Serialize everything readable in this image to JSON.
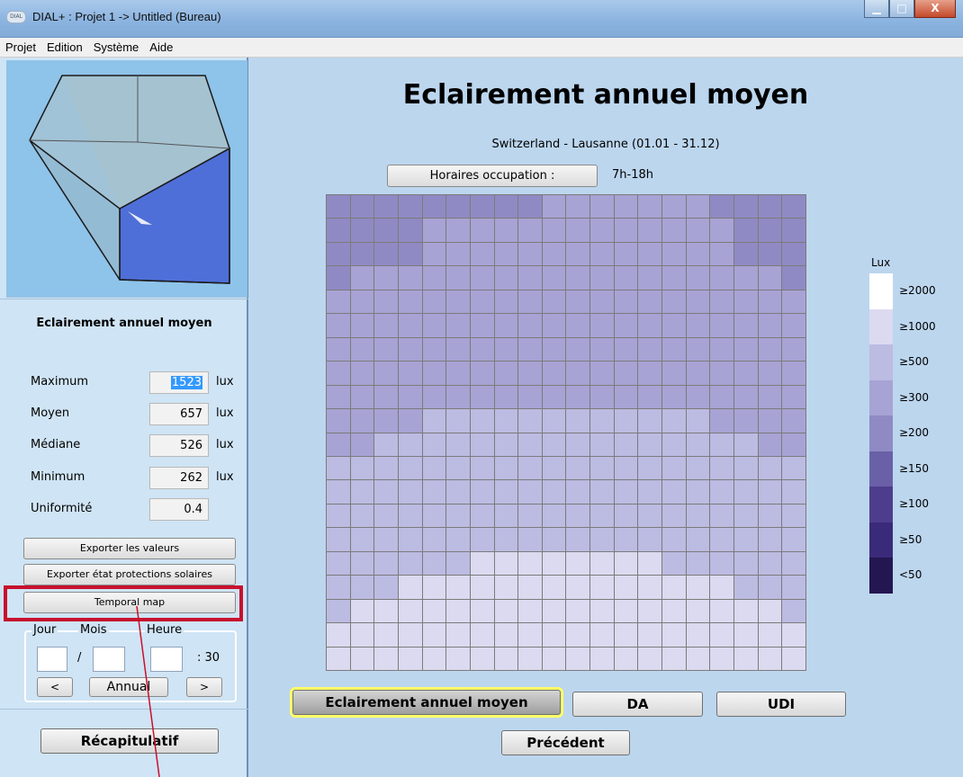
{
  "window": {
    "title": "DIAL+ : Projet 1 -> Untitled (Bureau)",
    "icon_text": "DIAL",
    "min_label": "▁",
    "max_label": "□",
    "close_label": "X"
  },
  "menu": [
    "Projet",
    "Edition",
    "Système",
    "Aide"
  ],
  "left": {
    "heading": "Eclairement annuel moyen",
    "stats": [
      {
        "label": "Maximum",
        "value": "1523",
        "unit": "lux"
      },
      {
        "label": "Moyen",
        "value": "657",
        "unit": "lux"
      },
      {
        "label": "Médiane",
        "value": "526",
        "unit": "lux"
      },
      {
        "label": "Minimum",
        "value": "262",
        "unit": "lux"
      },
      {
        "label": "Uniformité",
        "value": "0.4",
        "unit": ""
      }
    ],
    "export_values": "Exporter les valeurs",
    "export_protections": "Exporter état protections solaires",
    "temporal_map": "Temporal map",
    "date": {
      "jour": "Jour",
      "mois": "Mois",
      "heure": "Heure",
      "slash": "/",
      "minutes": ": 30",
      "prev": "<",
      "annual": "Annual",
      "next": ">"
    },
    "summary": "Récapitulatif"
  },
  "main": {
    "title": "Eclairement annuel moyen",
    "location": "Switzerland - Lausanne (01.01 - 31.12)",
    "horaires_label": "Horaires occupation :",
    "horaires_value": "7h-18h",
    "tabs": [
      "Eclairement annuel moyen",
      "DA",
      "UDI"
    ],
    "previous": "Précédent"
  },
  "legend": {
    "title": "Lux",
    "items": [
      {
        "label": "≥2000",
        "color": "#ffffff"
      },
      {
        "label": "≥1000",
        "color": "#dcdaf0"
      },
      {
        "label": "≥500",
        "color": "#bcbbe2"
      },
      {
        "label": "≥300",
        "color": "#a7a3d4"
      },
      {
        "label": "≥200",
        "color": "#8f8ac3"
      },
      {
        "label": "≥150",
        "color": "#6a60a8"
      },
      {
        "label": "≥100",
        "color": "#4e3d8d"
      },
      {
        "label": "≥50",
        "color": "#3a2a7a"
      },
      {
        "label": "<50",
        "color": "#241650"
      }
    ]
  },
  "grid_levels": [
    "44444444433333334444",
    "44443333333333333444",
    "44443333333333333444",
    "43333333333333333334",
    "33333333333333333333",
    "33333333333333333333",
    "33333333333333333333",
    "33333333333333333333",
    "33333333333333333333",
    "33332222222222223333",
    "33222222222222222233",
    "22222222222222222222",
    "22222222222222222222",
    "22222222222222222222",
    "22222222222222222222",
    "22222211111111222222",
    "22211111111111111222",
    "21111111111111111112",
    "11111111111111111111",
    "11111111111111111111"
  ]
}
